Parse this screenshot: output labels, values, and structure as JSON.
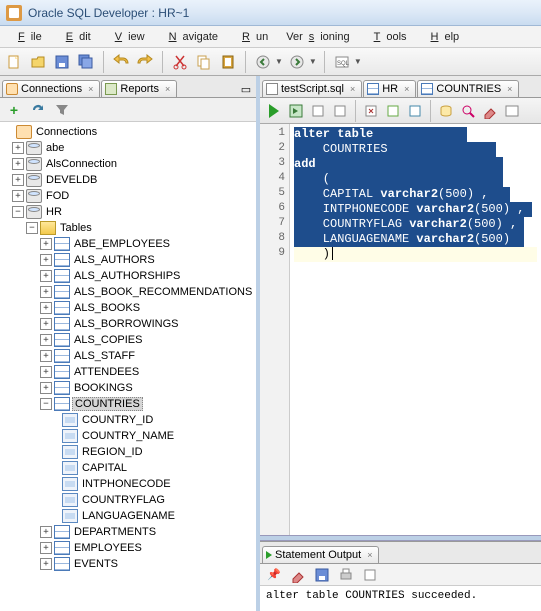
{
  "window": {
    "title": "Oracle SQL Developer : HR~1"
  },
  "menu": [
    "File",
    "Edit",
    "View",
    "Navigate",
    "Run",
    "Versioning",
    "Tools",
    "Help"
  ],
  "leftTabs": {
    "connections": "Connections",
    "reports": "Reports"
  },
  "tree": {
    "root": "Connections",
    "conn_abe": "abe",
    "conn_als": "AlsConnection",
    "conn_develdb": "DEVELDB",
    "conn_fod": "FOD",
    "conn_hr": "HR",
    "tables": "Tables",
    "t_abe_emp": "ABE_EMPLOYEES",
    "t_als_auth": "ALS_AUTHORS",
    "t_als_authsh": "ALS_AUTHORSHIPS",
    "t_als_book": "ALS_BOOK_RECOMMENDATIONS",
    "t_als_books": "ALS_BOOKS",
    "t_als_borrow": "ALS_BORROWINGS",
    "t_als_copies": "ALS_COPIES",
    "t_als_staff": "ALS_STAFF",
    "t_attendees": "ATTENDEES",
    "t_bookings": "BOOKINGS",
    "t_countries": "COUNTRIES",
    "c_country_id": "COUNTRY_ID",
    "c_country_name": "COUNTRY_NAME",
    "c_region_id": "REGION_ID",
    "c_capital": "CAPITAL",
    "c_intphone": "INTPHONECODE",
    "c_cflag": "COUNTRYFLAG",
    "c_lang": "LANGUAGENAME",
    "t_departments": "DEPARTMENTS",
    "t_employees": "EMPLOYEES",
    "t_events": "EVENTS"
  },
  "editorTabs": {
    "script": "testScript.sql",
    "hr": "HR",
    "countries": "COUNTRIES"
  },
  "code": {
    "l1a": "alter",
    "l1b": " table",
    "l2": "    COUNTRIES",
    "l3": "add",
    "l4": "    (",
    "l5a": "    CAPITAL ",
    "l5b": "varchar2",
    "l5c": "(500) ,",
    "l6a": "    INTPHONECODE ",
    "l6b": "varchar2",
    "l6c": "(500) ,",
    "l7a": "    COUNTRYFLAG ",
    "l7b": "varchar2",
    "l7c": "(500) ,",
    "l8a": "    LANGUAGENAME ",
    "l8b": "varchar2",
    "l8c": "(500)",
    "l9": "    )"
  },
  "gutterLines": [
    "1",
    "2",
    "3",
    "4",
    "5",
    "6",
    "7",
    "8",
    "9"
  ],
  "output": {
    "tab": "Statement Output",
    "text": "alter table COUNTRIES succeeded."
  }
}
